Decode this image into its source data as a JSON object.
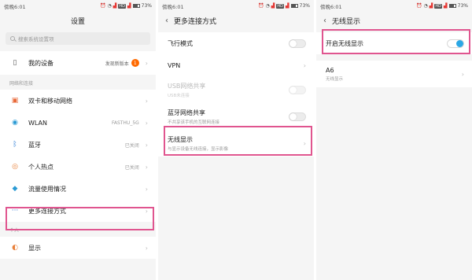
{
  "status": {
    "time": "傍晚6:01",
    "battery": "73%",
    "network": "HD"
  },
  "screen1": {
    "title": "设置",
    "search_placeholder": "搜索系统设置项",
    "my_device": {
      "label": "我的设备",
      "value": "发现新版本",
      "badge": "1"
    },
    "section_network": "网络和连接",
    "items": [
      {
        "label": "双卡和移动网络",
        "value": ""
      },
      {
        "label": "WLAN",
        "value": "FASTHU_5G"
      },
      {
        "label": "蓝牙",
        "value": "已关闭"
      },
      {
        "label": "个人热点",
        "value": "已关闭"
      },
      {
        "label": "流量使用情况",
        "value": ""
      },
      {
        "label": "更多连接方式",
        "value": ""
      }
    ],
    "section_personal": "个人",
    "display": {
      "label": "显示"
    }
  },
  "screen2": {
    "title": "更多连接方式",
    "items": [
      {
        "label": "飞行模式",
        "sub": ""
      },
      {
        "label": "VPN",
        "sub": ""
      },
      {
        "label": "USB网络共享",
        "sub": "USB未连接"
      },
      {
        "label": "蓝牙网络共享",
        "sub": "不共享该手机的互联网连接"
      },
      {
        "label": "无线显示",
        "sub": "与显示设备无线连接，显示影像"
      }
    ]
  },
  "screen3": {
    "title": "无线显示",
    "toggle_label": "开启无线显示",
    "toggle_on": true,
    "device": {
      "name": "A6",
      "sub": "无线显示"
    }
  },
  "colors": {
    "highlight": "#e0558f",
    "toggle_on": "#2ba7e5",
    "badge": "#ff6a00"
  }
}
